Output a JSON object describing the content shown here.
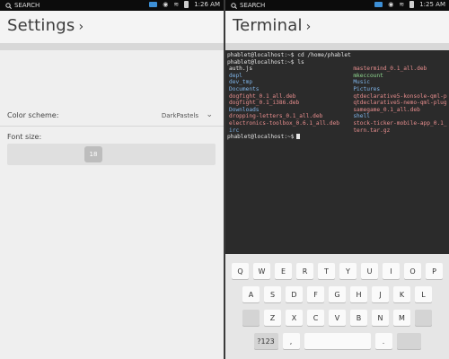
{
  "left": {
    "status": {
      "search": "SEARCH",
      "time": "1:26 AM"
    },
    "title": "Settings",
    "title_chevron": "›",
    "color_scheme_label": "Color scheme:",
    "color_scheme_value": "DarkPastels",
    "font_size_label": "Font size:",
    "font_size_value": "18"
  },
  "right": {
    "status": {
      "search": "SEARCH",
      "time": "1:25 AM"
    },
    "title": "Terminal",
    "title_chevron": "›",
    "terminal": {
      "prompt_lines": [
        "phablet@localhost:~$ cd /home/phablet",
        "phablet@localhost:~$ ls"
      ],
      "col1": [
        {
          "text": "auth.js",
          "color": "#e6e6e6"
        },
        {
          "text": "depl",
          "color": "#7fb4e8"
        },
        {
          "text": "dev_tmp",
          "color": "#7fb4e8"
        },
        {
          "text": "Documents",
          "color": "#7fb4e8"
        },
        {
          "text": "dogfight_0.1_all.deb",
          "color": "#e88e8e"
        },
        {
          "text": "dogfight_0.1_i386.deb",
          "color": "#e88e8e"
        },
        {
          "text": "Downloads",
          "color": "#7fb4e8"
        },
        {
          "text": "dropping-letters_0.1_all.deb",
          "color": "#e88e8e"
        },
        {
          "text": "electronics-toolbox_0.6.1_all.deb",
          "color": "#e88e8e"
        },
        {
          "text": "irc",
          "color": "#7fb4e8"
        }
      ],
      "col2": [
        {
          "text": "mastermind_0.1_all.deb",
          "color": "#e88e8e"
        },
        {
          "text": "mkeccount",
          "color": "#8fd88f"
        },
        {
          "text": "Music",
          "color": "#7fb4e8"
        },
        {
          "text": "Pictures",
          "color": "#7fb4e8"
        },
        {
          "text": "qtdeclarative5-konsole-qml-p",
          "color": "#e88e8e"
        },
        {
          "text": "qtdeclarative5-nemo-qml-plug",
          "color": "#e88e8e"
        },
        {
          "text": "samegame_0.1_all.deb",
          "color": "#e88e8e"
        },
        {
          "text": "shell",
          "color": "#7fb4e8"
        },
        {
          "text": "stock-ticker-mobile-app_0.1_",
          "color": "#e88e8e"
        },
        {
          "text": "tern.tar.gz",
          "color": "#e88e8e"
        }
      ],
      "last_prompt": "phablet@localhost:~$"
    },
    "keyboard": {
      "row1": [
        "Q",
        "W",
        "E",
        "R",
        "T",
        "Y",
        "U",
        "I",
        "O",
        "P"
      ],
      "row2": [
        "A",
        "S",
        "D",
        "F",
        "G",
        "H",
        "J",
        "K",
        "L"
      ],
      "row3": [
        "Z",
        "X",
        "C",
        "V",
        "B",
        "N",
        "M"
      ],
      "row4": {
        "sym": "?123",
        "comma": ",",
        "period": "."
      }
    }
  },
  "colors": {
    "terminal_bg": "#2b2b2b",
    "status_bg": "#0c0c0c",
    "mail_accent": "#3d8fd6"
  }
}
